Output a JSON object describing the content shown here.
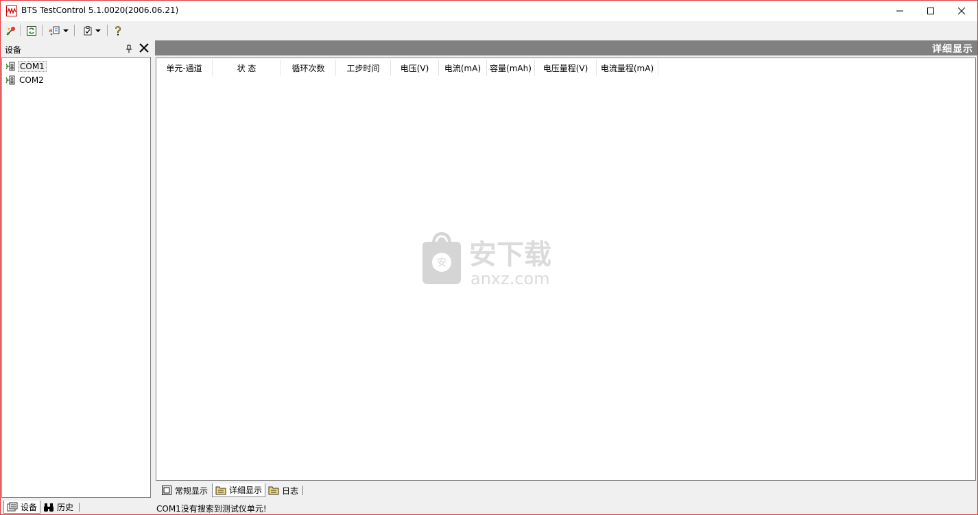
{
  "window": {
    "title": "BTS TestControl 5.1.0020(2006.06.21)",
    "accent": "#e0393b"
  },
  "toolbar": {
    "buttons": [
      {
        "icon": "connect-icon"
      },
      {
        "icon": "refresh-icon"
      },
      {
        "icon": "channel-tool-icon"
      },
      {
        "icon": "checklist-icon"
      },
      {
        "icon": "help-icon"
      }
    ]
  },
  "left_pane": {
    "title": "设备",
    "tree": [
      {
        "label": "COM1",
        "selected": true
      },
      {
        "label": "COM2",
        "selected": false
      }
    ],
    "tabs": [
      {
        "label": "设备",
        "icon": "device-tab-icon",
        "active": true
      },
      {
        "label": "历史",
        "icon": "binoculars-icon",
        "active": false
      }
    ]
  },
  "right_pane": {
    "title": "详细显示",
    "columns": [
      "单元-通道",
      "状 态",
      "循环次数",
      "工步时间",
      "电压(V)",
      "电流(mA)",
      "容量(mAh)",
      "电压量程(V)",
      "电流量程(mA)"
    ],
    "tabs": [
      {
        "label": "常规显示",
        "icon": "window-icon",
        "active": false
      },
      {
        "label": "详细显示",
        "icon": "folder-doc-icon",
        "active": true
      },
      {
        "label": "日志",
        "icon": "folder-doc-icon",
        "active": false
      }
    ]
  },
  "watermark": {
    "cn": "安下载",
    "url": "anxz.com",
    "badge": "安"
  },
  "status": {
    "message": "COM1没有搜索到测试仪单元!"
  }
}
